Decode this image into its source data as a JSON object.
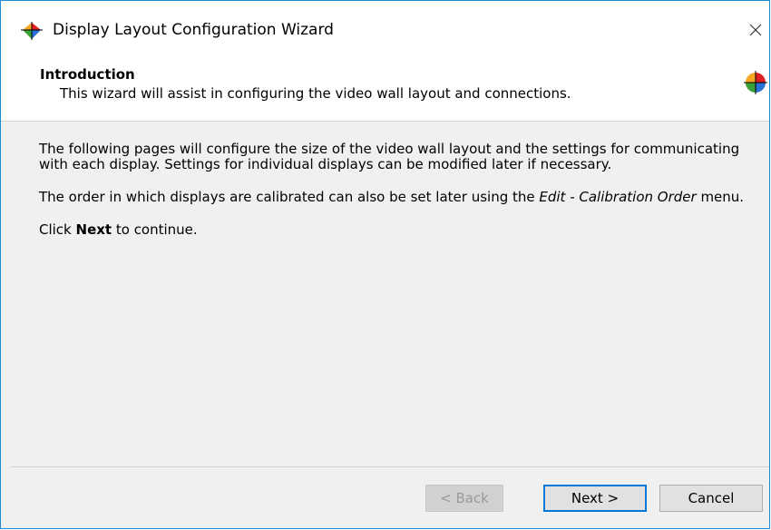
{
  "window": {
    "title": "Display Layout Configuration Wizard",
    "close_icon": "close-icon"
  },
  "header": {
    "title": "Introduction",
    "subtitle": "This wizard will assist in configuring the video wall layout and connections."
  },
  "content": {
    "paragraph1": "The following pages will configure the size of the video wall layout and the settings for communicating with each display. Settings for individual displays can be modified later if necessary.",
    "paragraph2_prefix": "The order in which displays are calibrated can also be set later using the ",
    "paragraph2_menu": "Edit - Calibration Order",
    "paragraph2_suffix": " menu.",
    "paragraph3_prefix": "Click ",
    "paragraph3_bold": "Next",
    "paragraph3_suffix": " to continue."
  },
  "buttons": {
    "back": "< Back",
    "next": "Next >",
    "cancel": "Cancel"
  },
  "colors": {
    "accent": "#0078d7",
    "window_border": "#1f8ad6"
  }
}
